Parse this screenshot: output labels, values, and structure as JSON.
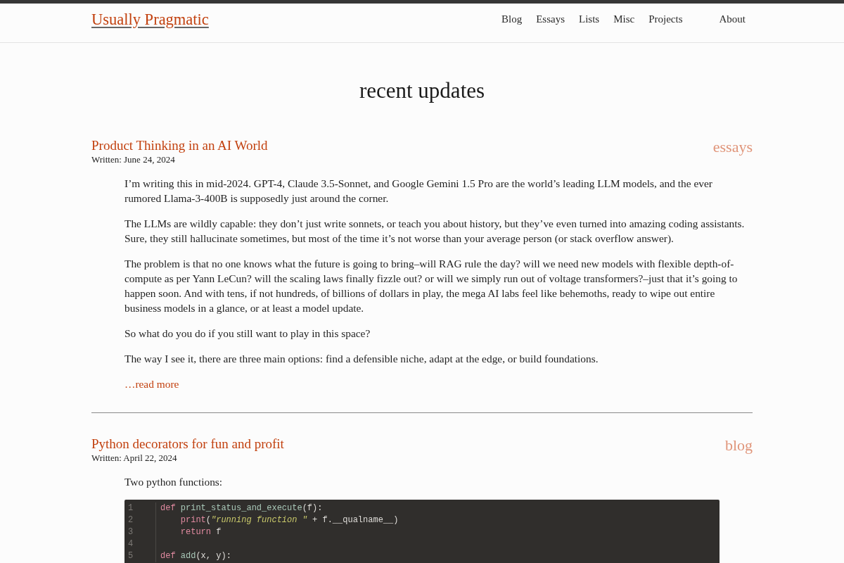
{
  "site_title": "Usually Pragmatic",
  "nav": [
    "Blog",
    "Essays",
    "Lists",
    "Misc",
    "Projects"
  ],
  "nav_end": "About",
  "heading": "recent updates",
  "posts": [
    {
      "title": "Product Thinking in an AI World",
      "written": "Written: June 24, 2024",
      "category": "essays",
      "paragraphs": [
        "I’m writing this in mid-2024. GPT-4, Claude 3.5-Sonnet, and Google Gemini 1.5 Pro are the world’s leading LLM models, and the ever rumored Llama-3-400B is supposedly just around the corner.",
        "The LLMs are wildly capable: they don’t just write sonnets, or teach you about history, but they’ve even turned into amazing coding assistants. Sure, they still hallucinate sometimes, but most of the time it’s not worse than your average person (or stack overflow answer).",
        "The problem is that no one knows what the future is going to bring–will RAG rule the day? will we need new models with flexible depth-of-compute as per Yann LeCun? will the scaling laws finally fizzle out? or will we simply run out of voltage transformers?–just that it’s going to happen soon. And with tens, if not hundreds, of billions of dollars in play, the mega AI labs feel like behemoths, ready to wipe out entire business models in a glance, or at least a model update.",
        "So what do you do if you still want to play in this space?",
        "The way I see it, there are three main options: find a defensible niche, adapt at the edge, or build foundations."
      ],
      "read_more": "…read more"
    },
    {
      "title": "Python decorators for fun and profit",
      "written": "Written: April 22, 2024",
      "category": "blog",
      "paragraphs": [
        "Two python functions:"
      ],
      "code": [
        {
          "number": "1",
          "indented": false,
          "tokens": [
            {
              "kind": "keyword",
              "text": "def "
            },
            {
              "kind": "function",
              "text": "print_status_and_execute"
            },
            {
              "kind": "plain",
              "text": "(f):"
            }
          ]
        },
        {
          "number": "2",
          "indented": true,
          "tokens": [
            {
              "kind": "builtin",
              "text": "print"
            },
            {
              "kind": "plain",
              "text": "("
            },
            {
              "kind": "string",
              "text": "\"running function \""
            },
            {
              "kind": "plain",
              "text": " + f.__qualname__)"
            }
          ]
        },
        {
          "number": "3",
          "indented": true,
          "tokens": [
            {
              "kind": "keyword",
              "text": "return"
            },
            {
              "kind": "plain",
              "text": " f"
            }
          ]
        },
        {
          "number": "4"
        },
        {
          "number": "5",
          "indented": false,
          "tokens": [
            {
              "kind": "keyword",
              "text": "def "
            },
            {
              "kind": "function",
              "text": "add"
            },
            {
              "kind": "plain",
              "text": "(x, y):"
            }
          ]
        }
      ]
    }
  ]
}
